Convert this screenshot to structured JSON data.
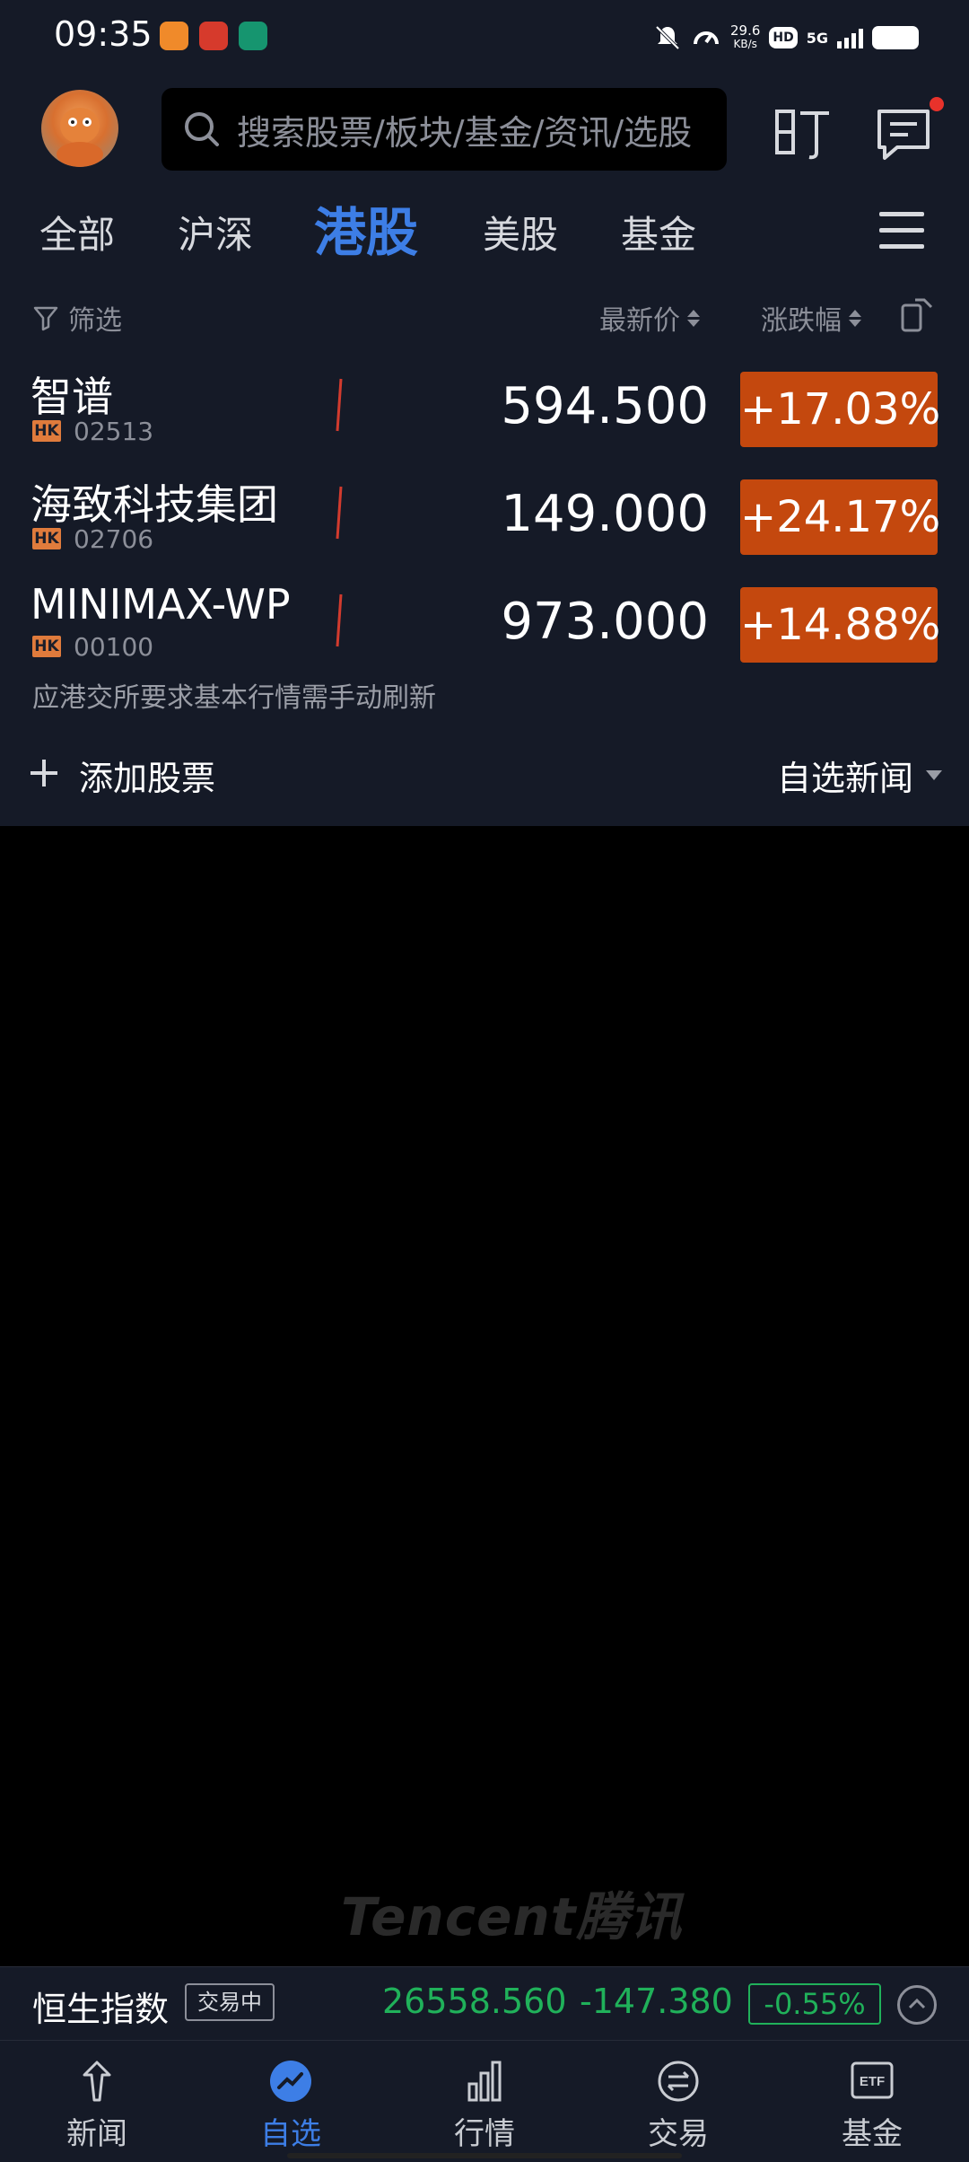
{
  "status_bar": {
    "time": "09:35",
    "net_speed_value": "29.6",
    "net_speed_unit": "KB/s",
    "hd": "HD",
    "network": "5G"
  },
  "header": {
    "search_placeholder": "搜索股票/板块/基金/资讯/选股",
    "icons": [
      "avatar",
      "search-icon",
      "ding-icon",
      "message-icon"
    ]
  },
  "tabs": [
    {
      "label": "全部",
      "active": false
    },
    {
      "label": "沪深",
      "active": false
    },
    {
      "label": "港股",
      "active": true
    },
    {
      "label": "美股",
      "active": false
    },
    {
      "label": "基金",
      "active": false
    }
  ],
  "list_header": {
    "filter": "筛选",
    "latest_price": "最新价",
    "change_pct": "涨跌幅"
  },
  "stocks": [
    {
      "name": "智谱",
      "market": "HK",
      "code": "02513",
      "price": "594.500",
      "change": "+17.03%"
    },
    {
      "name": "海致科技集团",
      "market": "HK",
      "code": "02706",
      "price": "149.000",
      "change": "+24.17%"
    },
    {
      "name": "MINIMAX-WP",
      "market": "HK",
      "code": "00100",
      "price": "973.000",
      "change": "+14.88%"
    }
  ],
  "notice": "应港交所要求基本行情需手动刷新",
  "add_stock": "添加股票",
  "news_filter": "自选新闻",
  "watermark": "Tencent腾讯",
  "index_bar": {
    "name": "恒生指数",
    "status": "交易中",
    "value": "26558.560",
    "delta": "-147.380",
    "pct": "-0.55%"
  },
  "bottom_nav": [
    {
      "label": "新闻",
      "icon": "news-icon",
      "active": false
    },
    {
      "label": "自选",
      "icon": "watchlist-icon",
      "active": true
    },
    {
      "label": "行情",
      "icon": "market-icon",
      "active": false
    },
    {
      "label": "交易",
      "icon": "trade-icon",
      "active": false
    },
    {
      "label": "基金",
      "icon": "etf-icon",
      "active": false
    }
  ],
  "colors": {
    "accent": "#3d7ee6",
    "up": "#c4480e",
    "down": "#20b15a",
    "background": "#151a27"
  }
}
